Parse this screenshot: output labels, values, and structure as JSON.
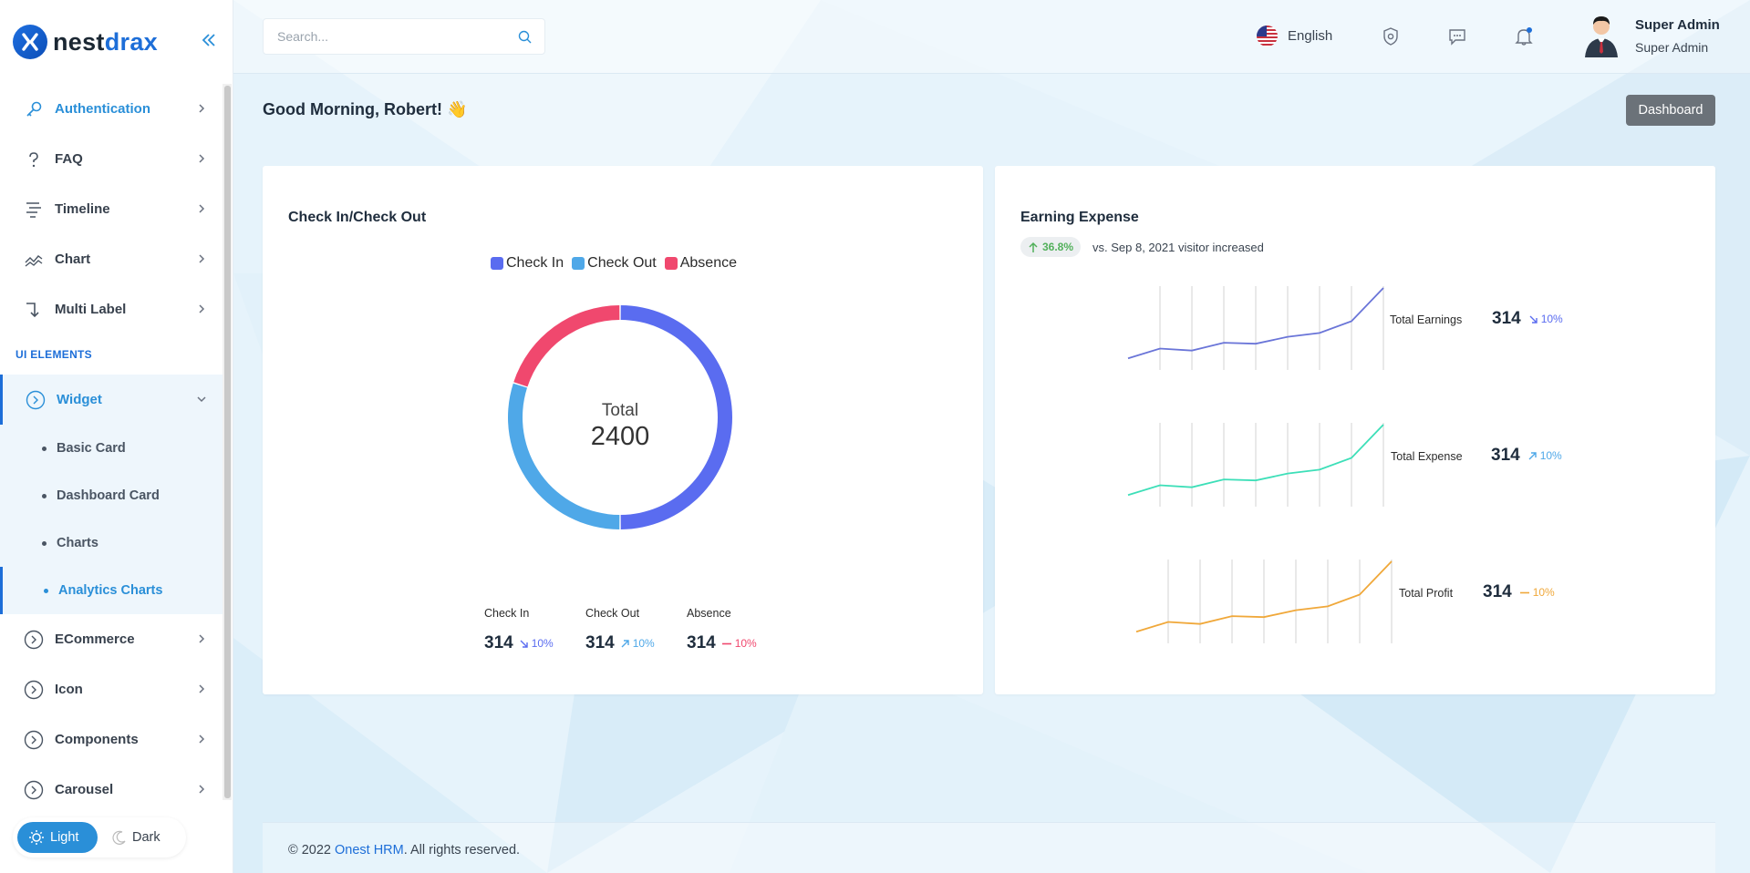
{
  "brand": {
    "name_part1": "nest",
    "name_part2": "drax"
  },
  "sidebar": {
    "items_top": [
      {
        "label": "Authentication",
        "icon": "key-icon"
      },
      {
        "label": "FAQ",
        "icon": "question-icon"
      },
      {
        "label": "Timeline",
        "icon": "timeline-icon"
      },
      {
        "label": "Chart",
        "icon": "chart-icon"
      },
      {
        "label": "Multi Label",
        "icon": "multi-label-icon"
      }
    ],
    "section_title": "UI ELEMENTS",
    "widget": {
      "label": "Widget",
      "icon": "circle-chevron-icon"
    },
    "widget_children": [
      "Basic Card",
      "Dashboard Card",
      "Charts",
      "Analytics Charts"
    ],
    "items_bottom": [
      {
        "label": "ECommerce",
        "icon": "circle-chevron-icon"
      },
      {
        "label": "Icon",
        "icon": "circle-chevron-icon"
      },
      {
        "label": "Components",
        "icon": "circle-chevron-icon"
      },
      {
        "label": "Carousel",
        "icon": "circle-chevron-icon"
      }
    ],
    "theme": {
      "light": "Light",
      "dark": "Dark"
    }
  },
  "header": {
    "search_placeholder": "Search...",
    "language": "English",
    "user_name": "Super Admin",
    "user_role": "Super Admin"
  },
  "page": {
    "greeting": "Good Morning, Robert! 👋",
    "breadcrumb_button": "Dashboard"
  },
  "checkin_card": {
    "title": "Check In/Check Out",
    "center_label": "Total",
    "center_value": "2400",
    "stats": [
      {
        "label": "Check In",
        "value": "314",
        "pct": "10%",
        "trend": "down",
        "color": "#5a6cf0"
      },
      {
        "label": "Check Out",
        "value": "314",
        "pct": "10%",
        "trend": "up",
        "color": "#4fa8e8"
      },
      {
        "label": "Absence",
        "value": "314",
        "pct": "10%",
        "trend": "flat",
        "color": "#f0486e"
      }
    ]
  },
  "chart_data": [
    {
      "type": "pie",
      "legend": [
        "Check In",
        "Check Out",
        "Absence"
      ],
      "labels": [
        "Check In",
        "Check Out",
        "Absence"
      ],
      "values": [
        50,
        30,
        20
      ],
      "colors": [
        "#5a6cf0",
        "#4fa8e8",
        "#f0486e"
      ],
      "donut": true,
      "legend_position": "top"
    },
    {
      "type": "line",
      "series": [
        {
          "name": "Total Earnings",
          "values": [
            10,
            20,
            18,
            26,
            25,
            32,
            36,
            48,
            82
          ]
        }
      ],
      "color": "#6a75d8"
    },
    {
      "type": "line",
      "series": [
        {
          "name": "Total Expense",
          "values": [
            10,
            20,
            18,
            26,
            25,
            32,
            36,
            48,
            82
          ]
        }
      ],
      "color": "#3ddfb8"
    },
    {
      "type": "line",
      "series": [
        {
          "name": "Total Profit",
          "values": [
            10,
            20,
            18,
            26,
            25,
            32,
            36,
            48,
            82
          ]
        }
      ],
      "color": "#f0a83a"
    }
  ],
  "earning_card": {
    "title": "Earning Expense",
    "trend_pct": "36.8%",
    "trend_text": "vs. Sep 8, 2021 visitor increased",
    "rows": [
      {
        "label": "Total Earnings",
        "value": "314",
        "pct": "10%",
        "trend": "down",
        "pct_color": "#5a6cf0"
      },
      {
        "label": "Total Expense",
        "value": "314",
        "pct": "10%",
        "trend": "up",
        "pct_color": "#4fa8e8"
      },
      {
        "label": "Total Profit",
        "value": "314",
        "pct": "10%",
        "trend": "flat",
        "pct_color": "#f0a83a"
      }
    ]
  },
  "footer": {
    "prefix": "© 2022 ",
    "link": "Onest HRM",
    "suffix": ". All rights reserved."
  }
}
